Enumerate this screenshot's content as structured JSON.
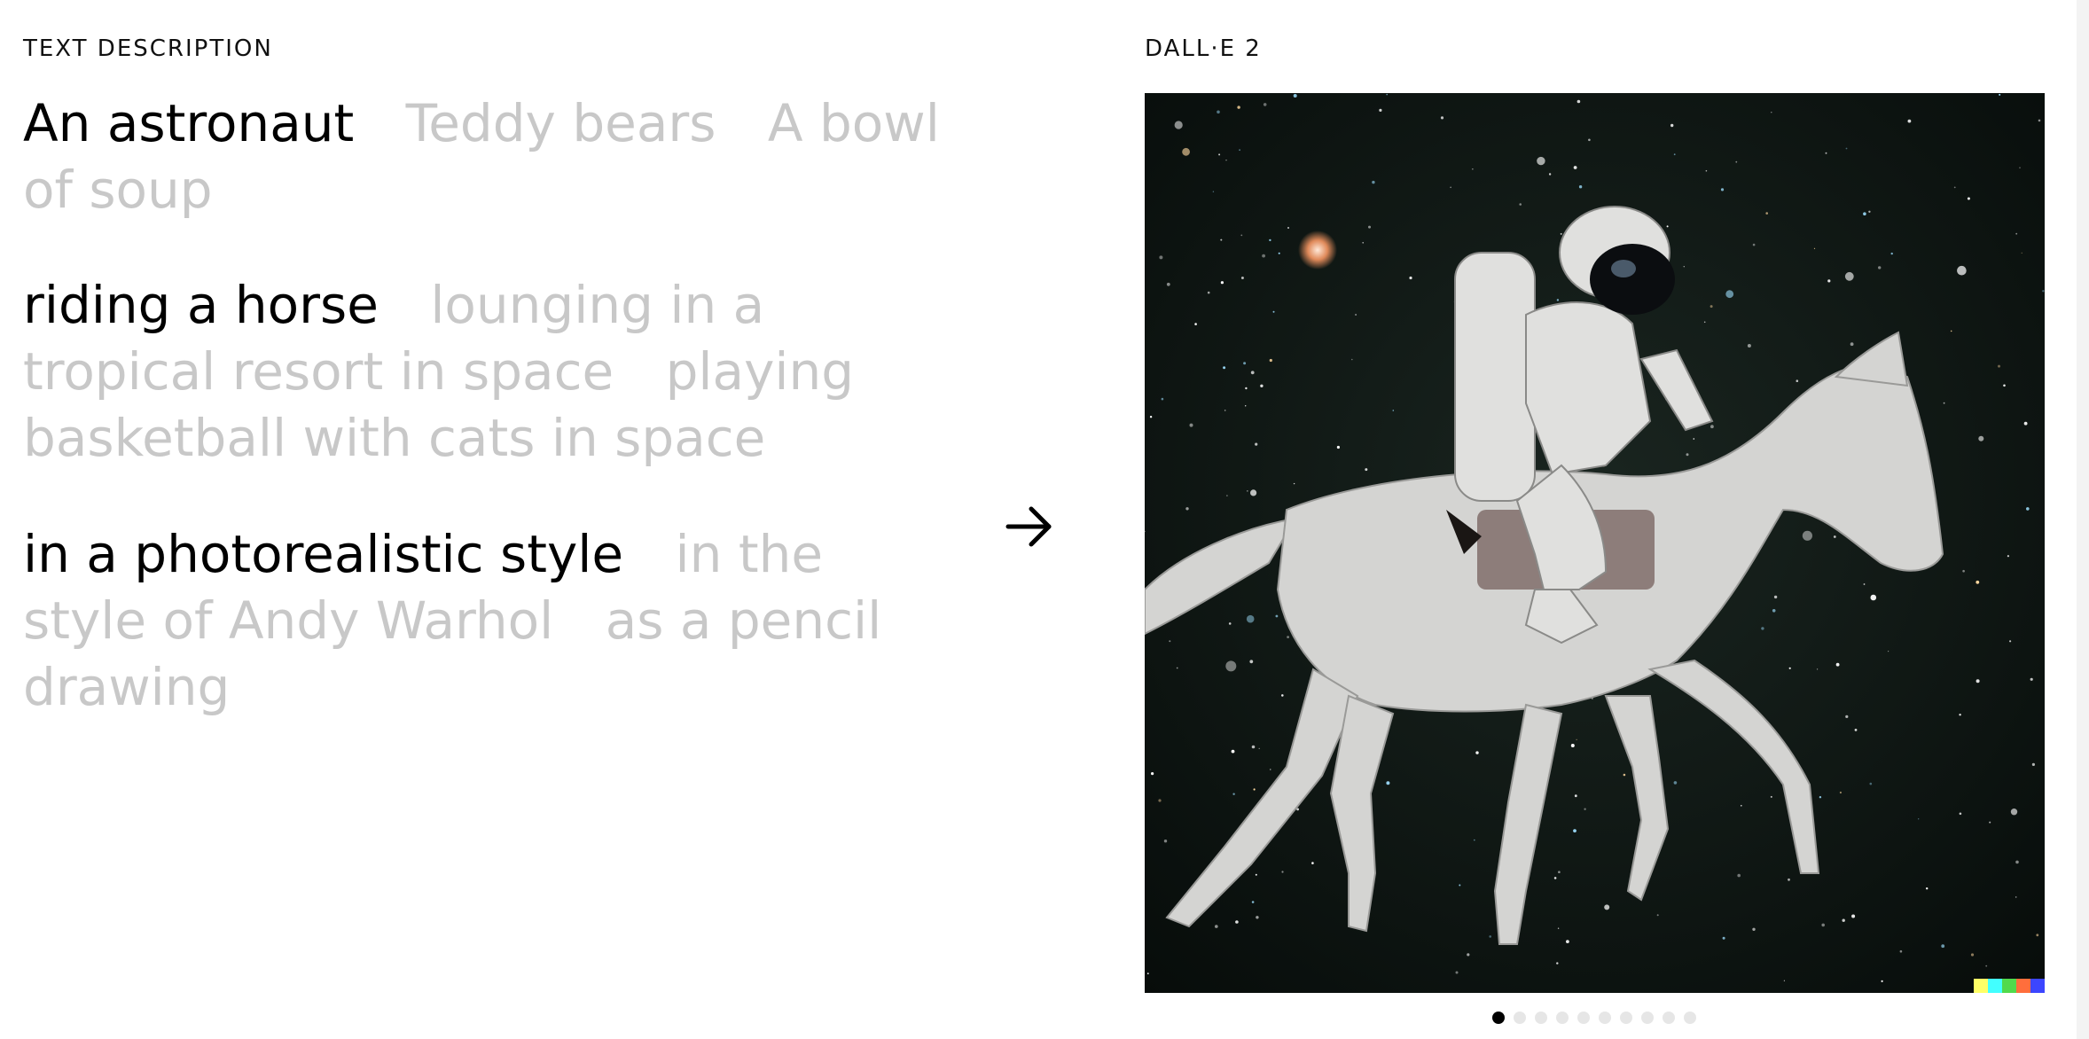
{
  "left_label": "TEXT DESCRIPTION",
  "right_label": "DALL·E 2",
  "groups": [
    {
      "name": "subject",
      "options": [
        "An astronaut",
        "Teddy bears",
        "A bowl of soup"
      ],
      "selected": 0
    },
    {
      "name": "action",
      "options": [
        "riding a horse",
        "lounging in a tropical resort in space",
        "playing basketball with cats in space"
      ],
      "selected": 0
    },
    {
      "name": "style",
      "options": [
        "in a photorealistic style",
        "in the style of Andy Warhol",
        "as a pencil drawing"
      ],
      "selected": 0
    }
  ],
  "arrow_icon": "arrow-right-icon",
  "carousel": {
    "count": 10,
    "active": 0
  },
  "watermark_colors": [
    "#ffff66",
    "#42ffff",
    "#51da4c",
    "#ff6e3c",
    "#3c46ff"
  ],
  "colors": {
    "selected": "#000000",
    "unselected": "#c8c8c8",
    "image_bg": "#0c1512"
  }
}
